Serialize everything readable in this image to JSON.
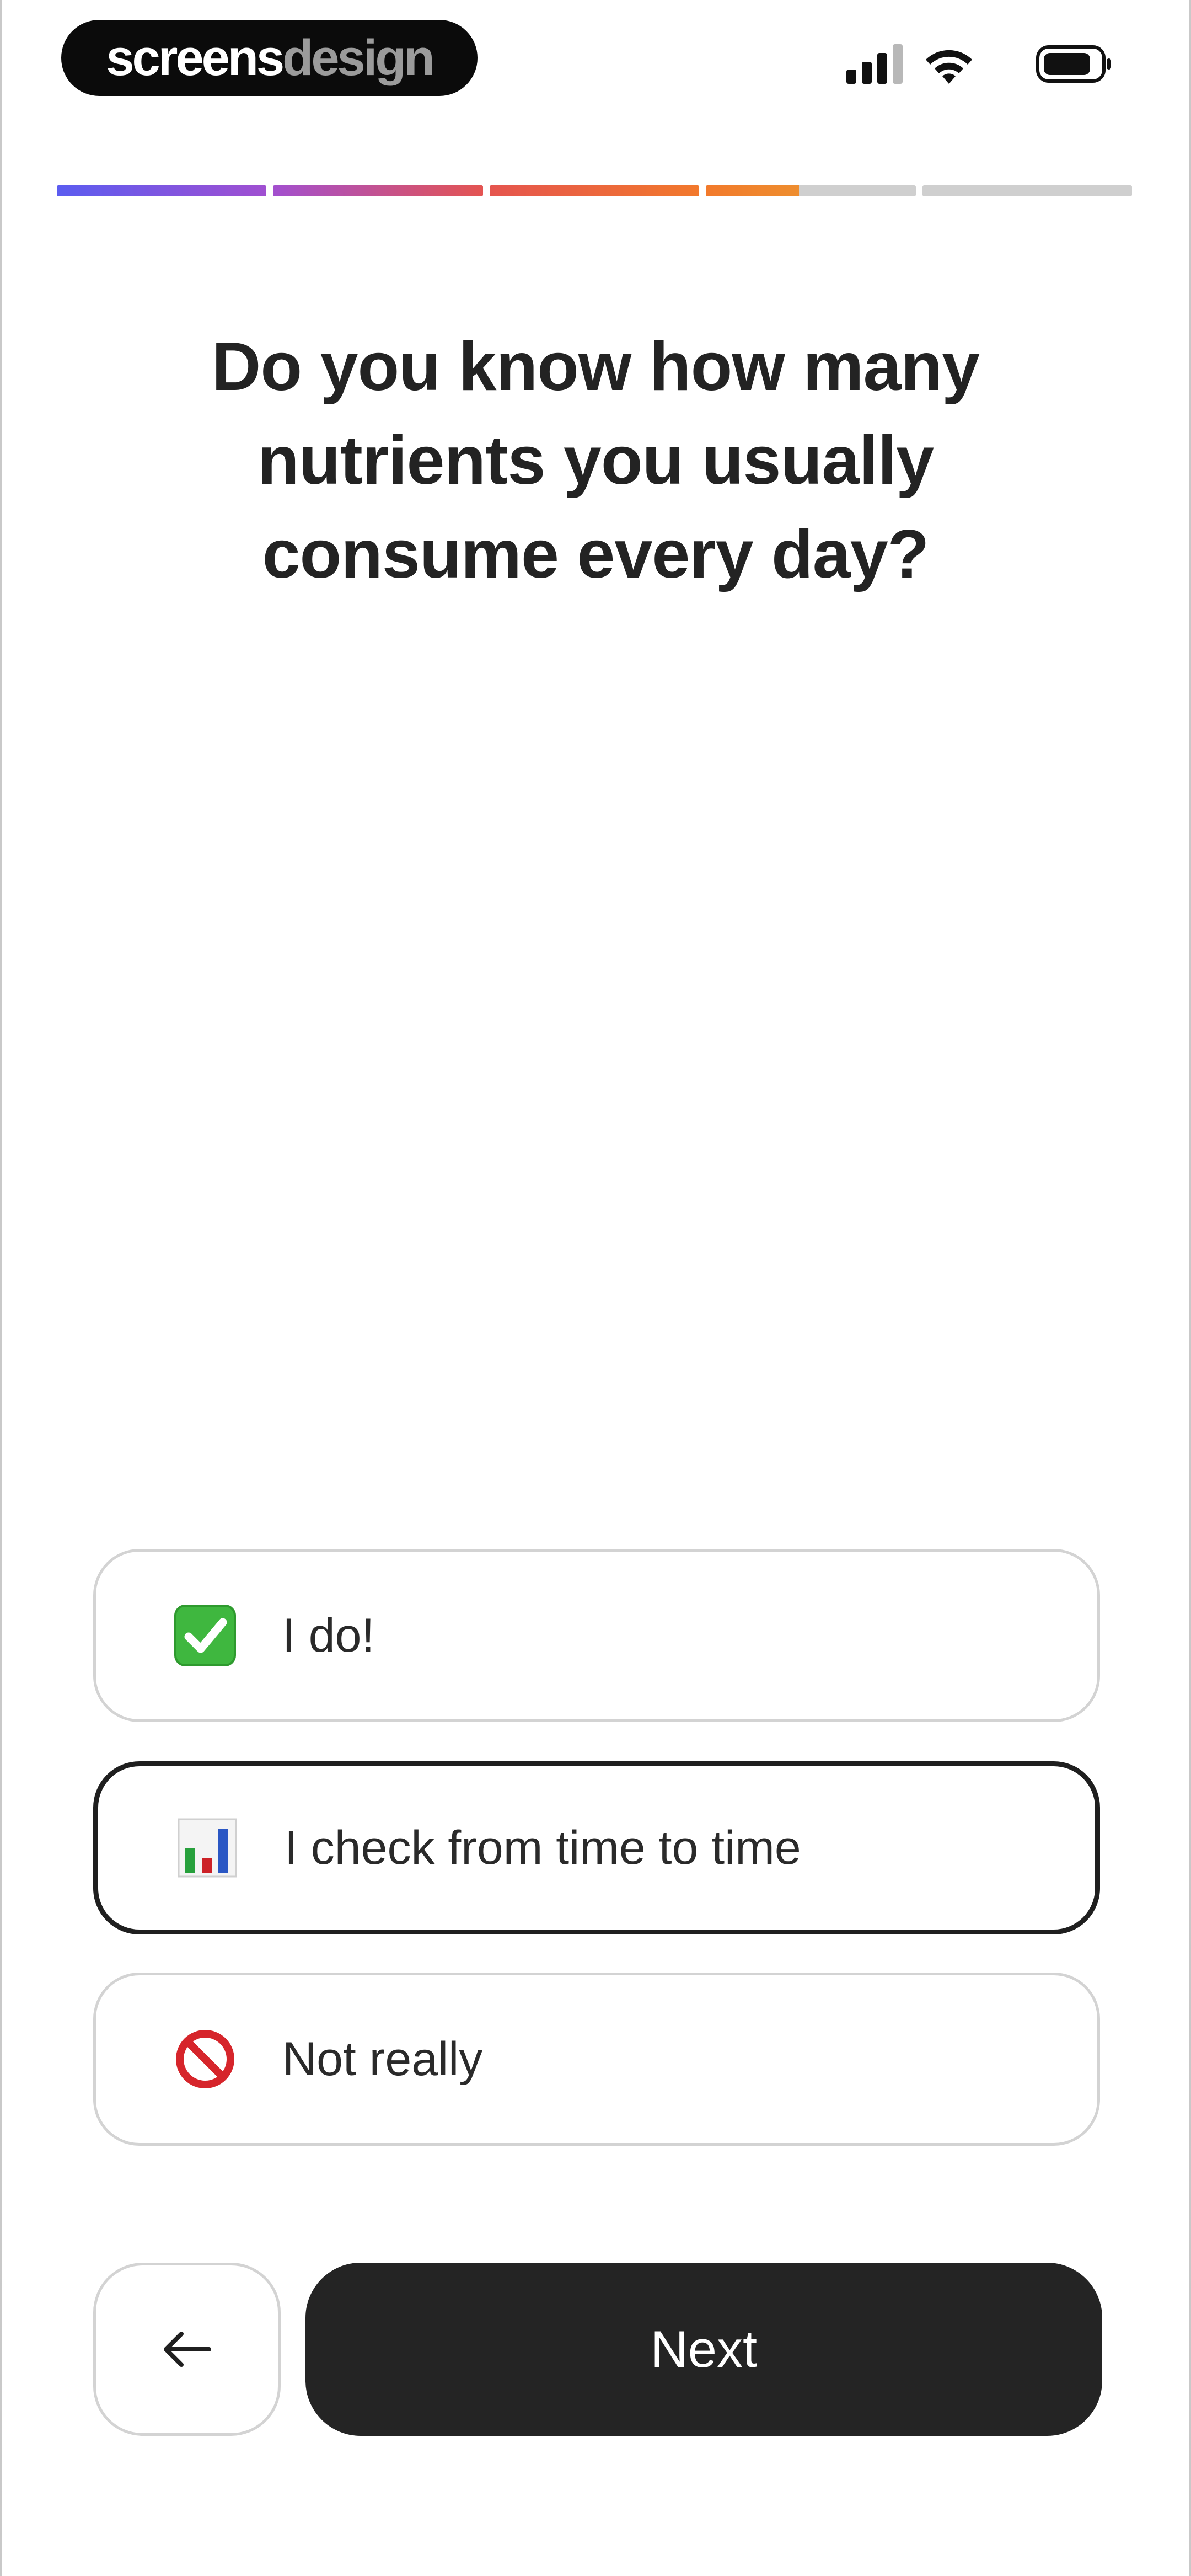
{
  "brand": {
    "part1": "screens",
    "part2": "design"
  },
  "status_bar": {
    "icons": [
      "cellular-signal-icon",
      "wifi-icon",
      "battery-icon"
    ]
  },
  "progress": {
    "segment_count": 5,
    "fraction_complete": 0.69,
    "gradient_colors": [
      "#5b5cf0",
      "#a24fd0",
      "#e5544f",
      "#f2792b",
      "#e9a634",
      "#cfb02a"
    ],
    "empty_color": "#cfcfcf"
  },
  "question": {
    "line1": "Do you know how many",
    "line2": "nutrients you usually",
    "line3": "consume every day?"
  },
  "options": [
    {
      "icon": "check-mark-icon",
      "label": "I do!",
      "selected": false
    },
    {
      "icon": "bar-chart-icon",
      "label": "I check from time to time",
      "selected": true
    },
    {
      "icon": "prohibited-icon",
      "label": "Not really",
      "selected": false
    }
  ],
  "navigation": {
    "back_icon": "arrow-left-icon",
    "next_label": "Next"
  }
}
